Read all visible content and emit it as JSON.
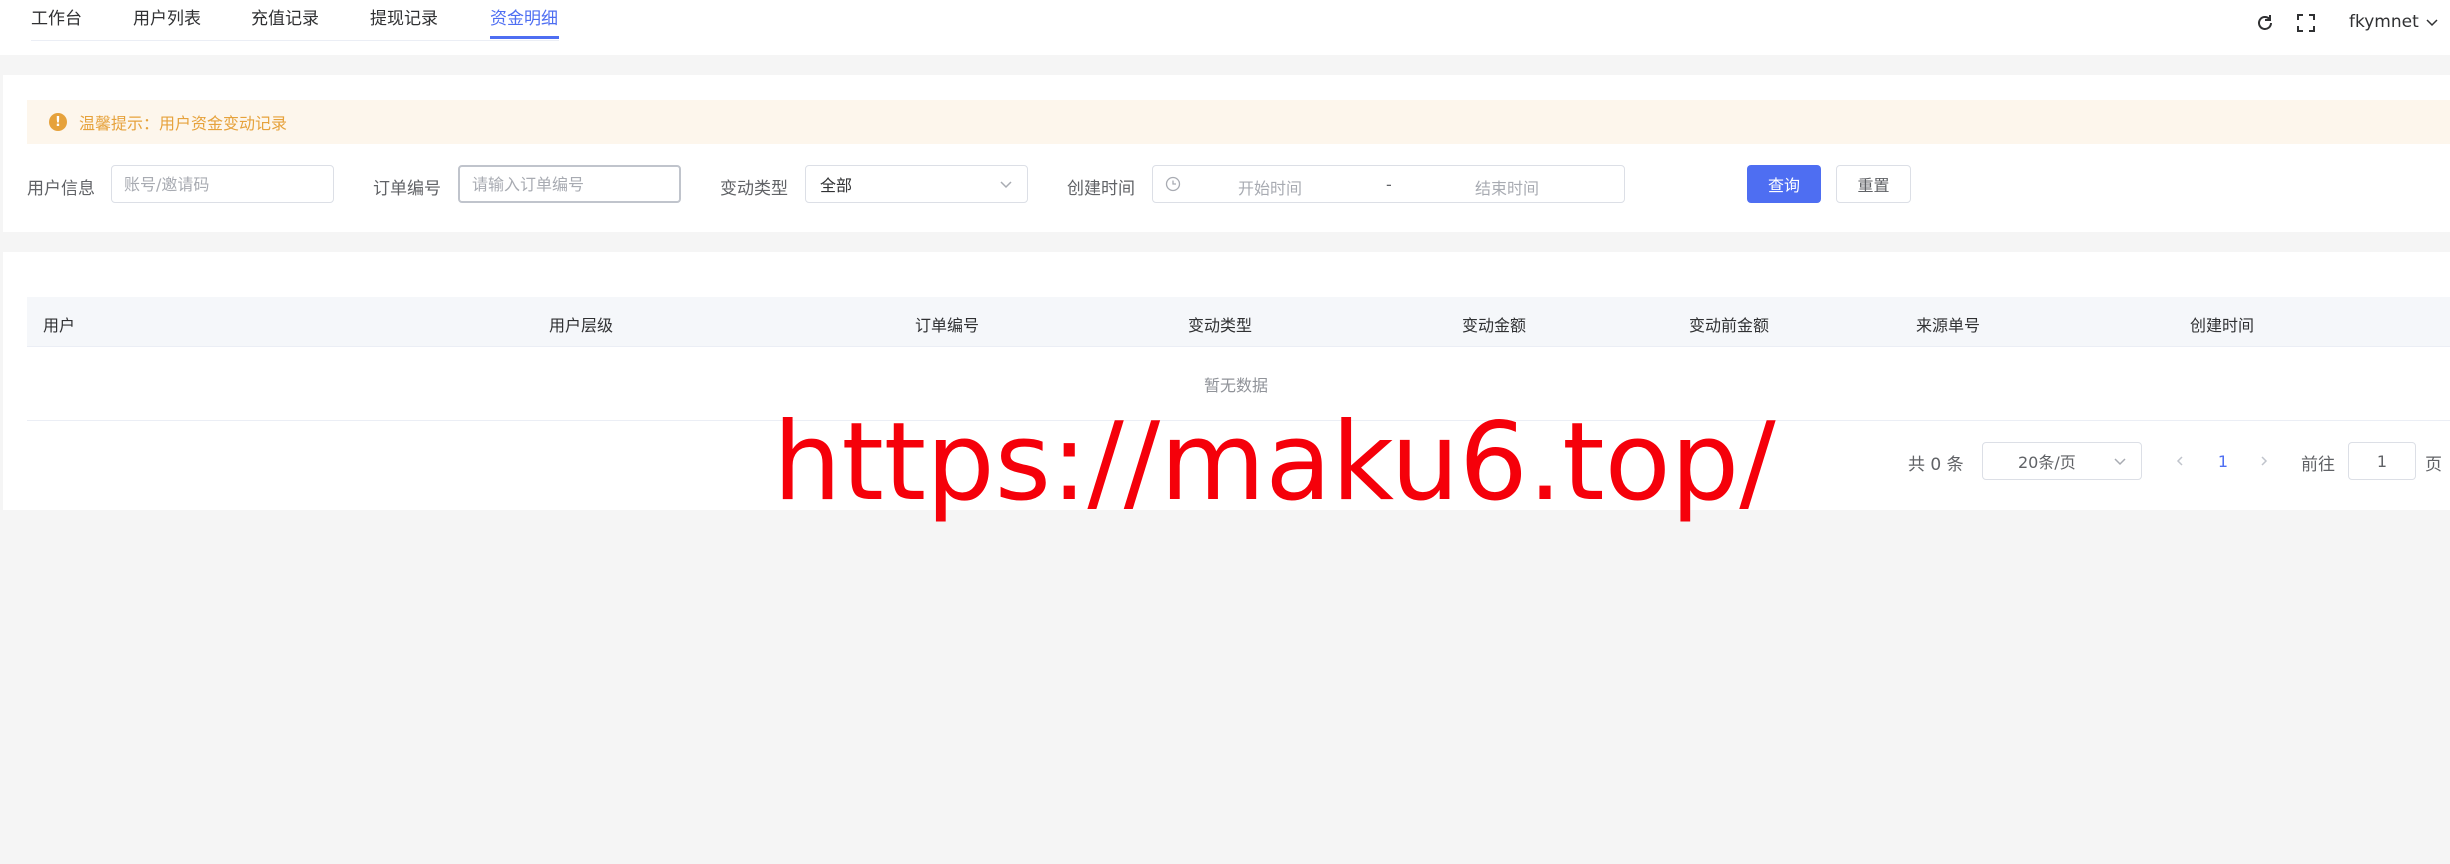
{
  "tabs": [
    {
      "label": "工作台"
    },
    {
      "label": "用户列表"
    },
    {
      "label": "充值记录"
    },
    {
      "label": "提现记录"
    },
    {
      "label": "资金明细"
    }
  ],
  "active_tab": "资金明细",
  "user_menu": {
    "username": "fkymnet"
  },
  "icons": {
    "refresh": "refresh-icon",
    "fullscreen": "fullscreen-icon",
    "dropdown": "chevron-down-icon"
  },
  "alert": {
    "text": "温馨提示：用户资金变动记录"
  },
  "filters": {
    "user_info": {
      "label": "用户信息",
      "placeholder": "账号/邀请码"
    },
    "order_no": {
      "label": "订单编号",
      "placeholder": "请输入订单编号"
    },
    "change_type": {
      "label": "变动类型",
      "value": "全部"
    },
    "create_time": {
      "label": "创建时间",
      "start_placeholder": "开始时间",
      "separator": "-",
      "end_placeholder": "结束时间"
    },
    "search_label": "查询",
    "reset_label": "重置"
  },
  "table": {
    "columns": [
      "用户",
      "用户层级",
      "订单编号",
      "变动类型",
      "变动金额",
      "变动前金额",
      "来源单号",
      "创建时间"
    ],
    "empty_text": "暂无数据"
  },
  "pagination": {
    "total_text": "共 0 条",
    "page_size": "20条/页",
    "current_page": "1",
    "goto_label": "前往",
    "goto_value": "1",
    "page_suffix": "页"
  },
  "watermark": {
    "text": "https://maku6.top/"
  },
  "colors": {
    "accent": "#4e6ef2",
    "warning": "#e6a23c",
    "watermark": "#f5000a"
  }
}
